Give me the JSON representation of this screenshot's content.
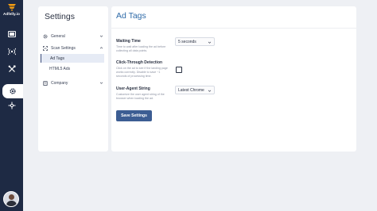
{
  "brand": {
    "name": "Adfelly.io",
    "accent": "#f39c12"
  },
  "rail": {
    "items": [
      {
        "name": "dashboard-icon"
      },
      {
        "name": "broadcast-icon"
      },
      {
        "name": "tools-icon"
      },
      {
        "name": "settings-icon",
        "active": true
      },
      {
        "name": "integrations-icon"
      }
    ]
  },
  "settings": {
    "title": "Settings",
    "nav": [
      {
        "label": "General",
        "icon": "gear-icon",
        "expanded": false
      },
      {
        "label": "Scan Settings",
        "icon": "scan-icon",
        "expanded": true,
        "children": [
          {
            "label": "Ad Tags",
            "active": true
          },
          {
            "label": "HTML5 Ads"
          }
        ]
      },
      {
        "label": "Company",
        "icon": "building-icon",
        "expanded": false
      }
    ]
  },
  "main": {
    "title": "Ad Tags",
    "fields": {
      "waiting_time": {
        "label": "Waiting Time",
        "help": "Time to wait after loading the ad before collecting all data points.",
        "value": "5 seconds"
      },
      "click_through": {
        "label": "Click-Through Detection",
        "help": "Click on the ad to see if the landing page works correctly. Disable to save ~1 seconds of processing time.",
        "checked": false
      },
      "user_agent": {
        "label": "User-Agent String",
        "help": "Customize the user agent string of the browser when loading the ad.",
        "value": "Latest Chrome"
      }
    },
    "save_label": "Save Settings"
  },
  "colors": {
    "rail_bg": "#1e2a44",
    "primary_button": "#3c5d93",
    "title_blue": "#2e6aa8"
  }
}
